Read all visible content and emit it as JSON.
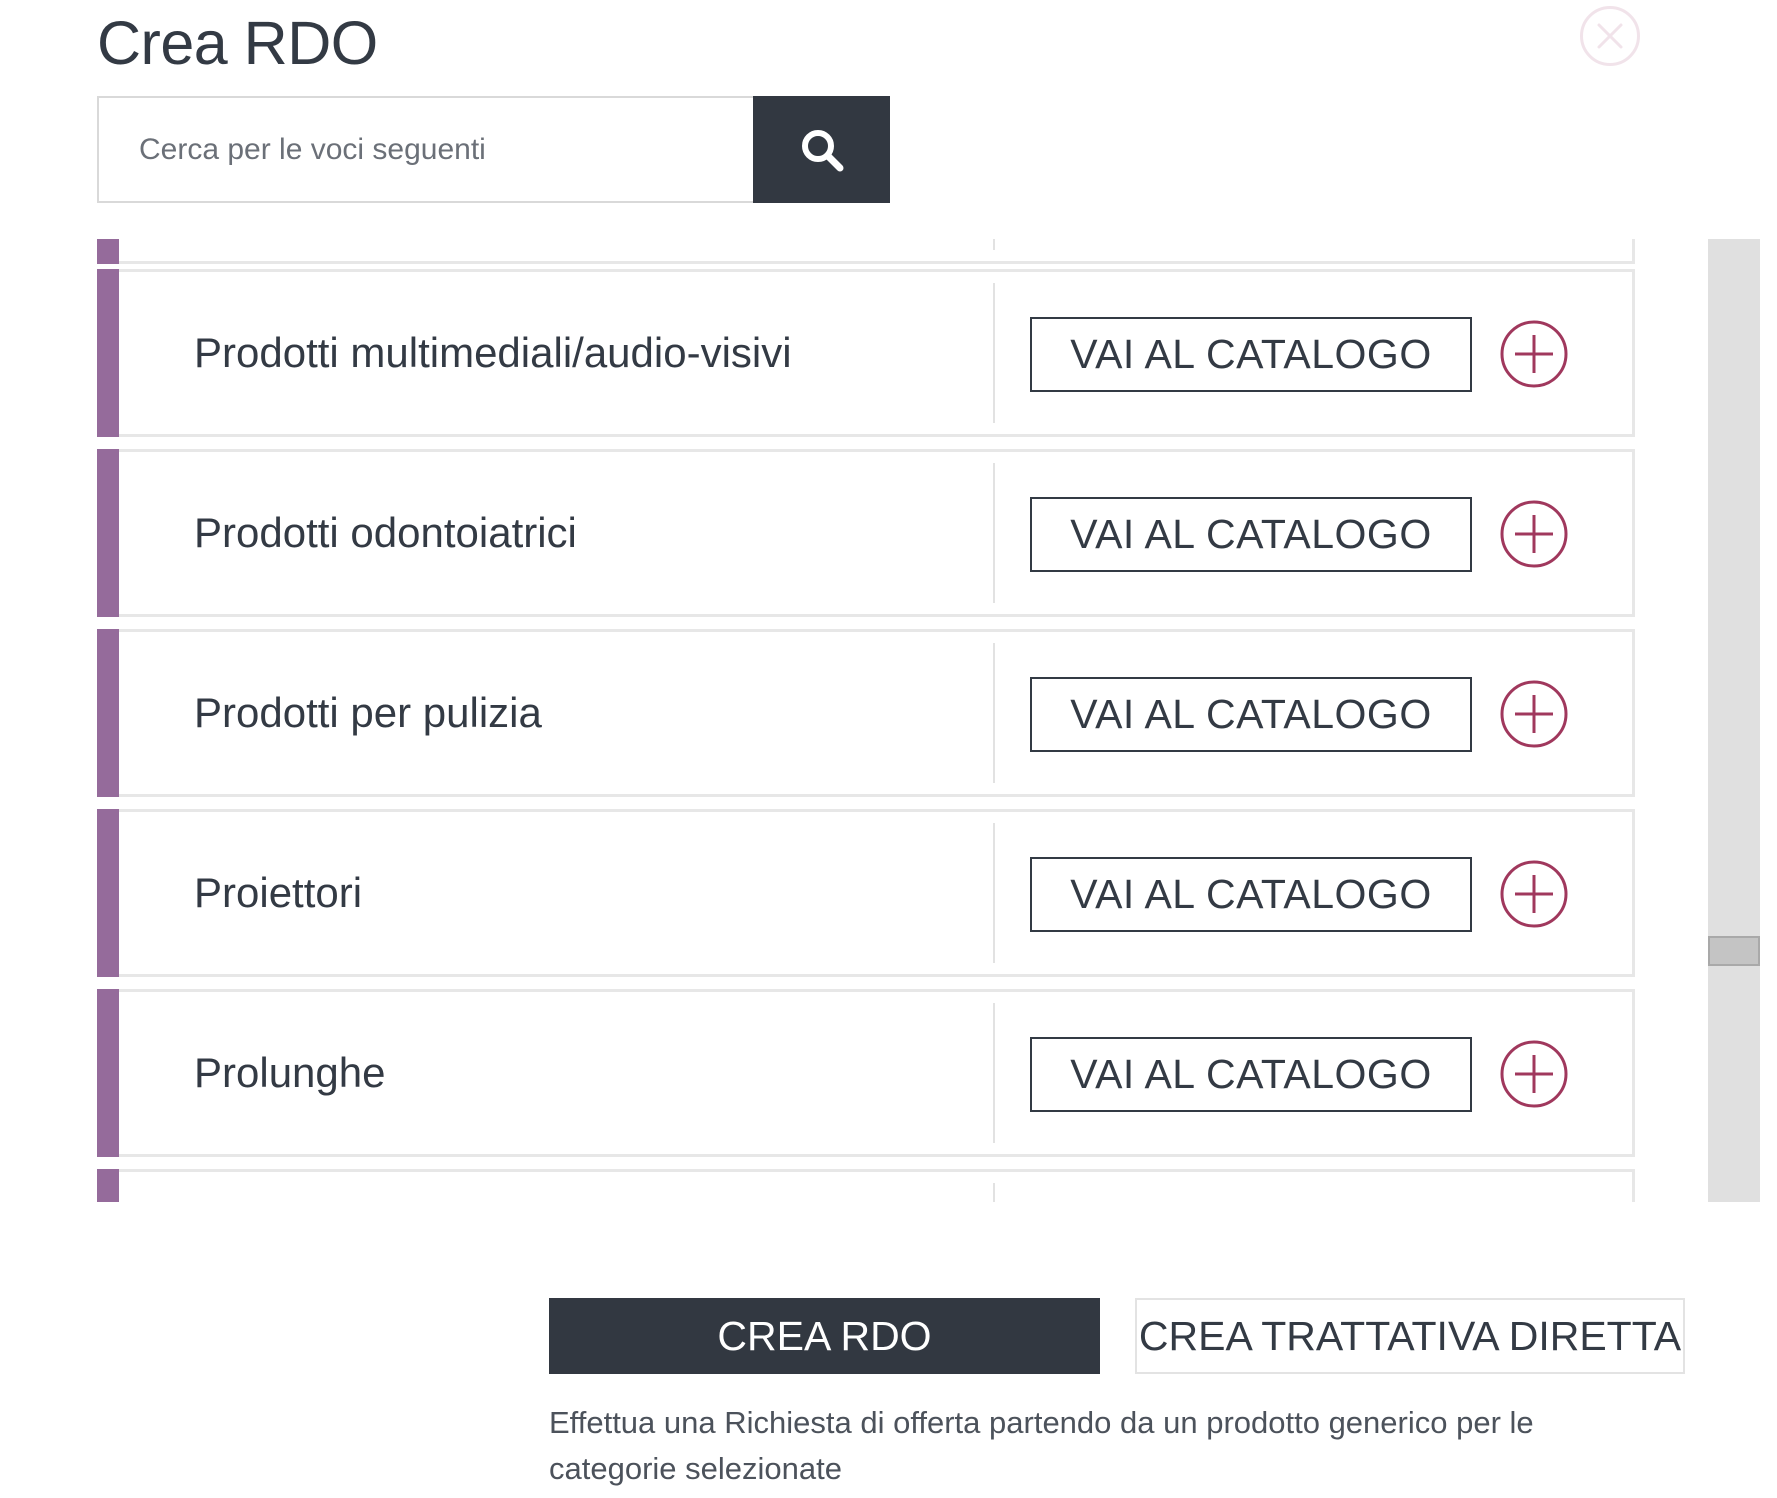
{
  "dialog": {
    "title": "Crea RDO"
  },
  "search": {
    "placeholder": "Cerca per le voci seguenti",
    "value": ""
  },
  "colors": {
    "accent": "#956b9b",
    "dark": "#323841",
    "plus_icon": "#a0385d",
    "close_icon": "#f1e3ea"
  },
  "categories": [
    {
      "label": "Prodotti multimediali/audio-visivi",
      "action_label": "VAI AL CATALOGO"
    },
    {
      "label": "Prodotti odontoiatrici",
      "action_label": "VAI AL CATALOGO"
    },
    {
      "label": "Prodotti per pulizia",
      "action_label": "VAI AL CATALOGO"
    },
    {
      "label": "Proiettori",
      "action_label": "VAI AL CATALOGO"
    },
    {
      "label": "Prolunghe",
      "action_label": "VAI AL CATALOGO"
    }
  ],
  "footer": {
    "primary_label": "CREA RDO",
    "secondary_label": "CREA TRATTATIVA DIRETTA",
    "description": "Effettua una Richiesta di offerta partendo da un prodotto generico per le categorie selezionate"
  },
  "icons": {
    "close": "close-icon",
    "search": "search-icon",
    "add": "plus-circle-icon"
  }
}
